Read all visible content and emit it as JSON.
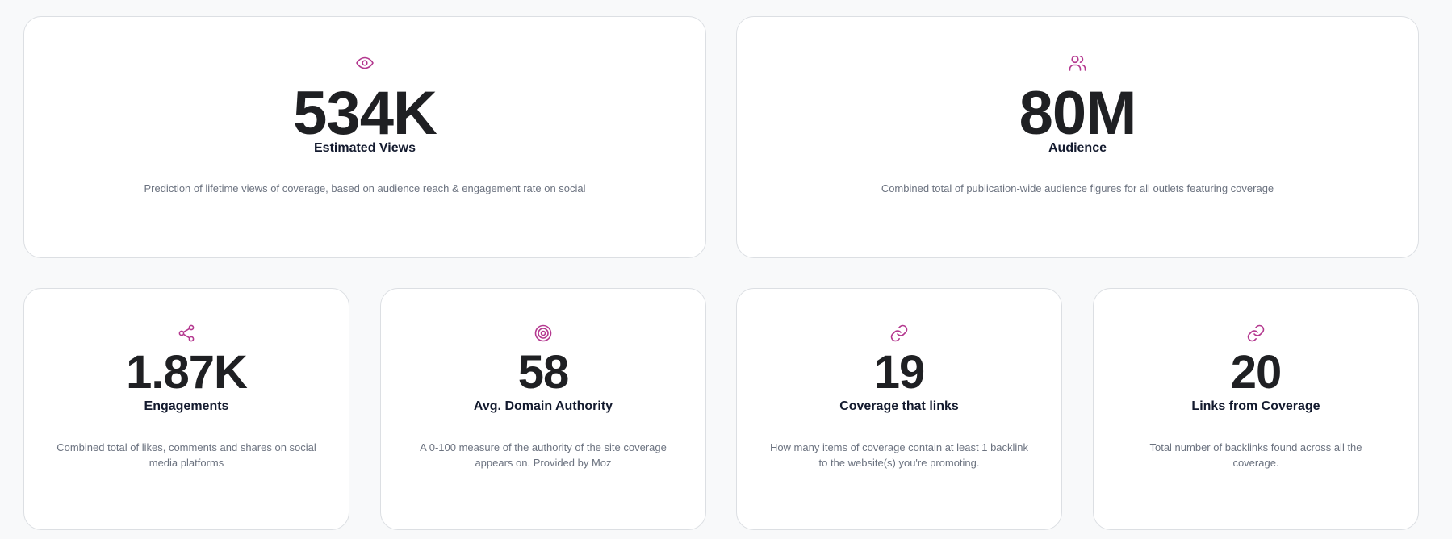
{
  "accent_color": "#b4388f",
  "cards": {
    "views": {
      "icon": "eye-icon",
      "value": "534K",
      "label": "Estimated Views",
      "description": "Prediction of lifetime views of coverage, based on audience reach & engagement rate on social"
    },
    "audience": {
      "icon": "users-icon",
      "value": "80M",
      "label": "Audience",
      "description": "Combined total of publication-wide audience figures for all outlets featuring coverage"
    },
    "engagements": {
      "icon": "share-icon",
      "value": "1.87K",
      "label": "Engagements",
      "description": "Combined total of likes, comments and shares on social media platforms"
    },
    "domain_authority": {
      "icon": "target-icon",
      "value": "58",
      "label": "Avg. Domain Authority",
      "description": "A 0-100 measure of the authority of the site coverage appears on. Provided by Moz"
    },
    "coverage_links": {
      "icon": "link-icon",
      "value": "19",
      "label": "Coverage that links",
      "description": "How many items of coverage contain at least 1 backlink to the website(s) you're promoting."
    },
    "links_from_coverage": {
      "icon": "link-icon",
      "value": "20",
      "label": "Links from Coverage",
      "description": "Total number of backlinks found across all the coverage."
    }
  }
}
